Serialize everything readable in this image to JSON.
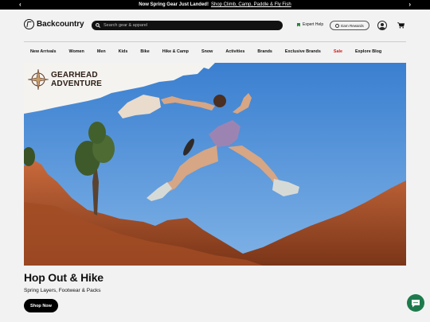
{
  "promo": {
    "text": "Now Spring Gear Just Landed!",
    "link": "Shop Climb, Camp, Paddle & Fly Fish",
    "prev_icon": "chevron-left-icon",
    "next_icon": "chevron-right-icon"
  },
  "header": {
    "logo": "Backcountry",
    "search_placeholder": "Search gear & apparel",
    "expert_help": "Expert Help",
    "rewards": "Earn Rewards"
  },
  "nav": {
    "items": [
      "New Arrivals",
      "Women",
      "Men",
      "Kids",
      "Bike",
      "Hike & Camp",
      "Snow",
      "Activities",
      "Brands",
      "Exclusive Brands",
      "Sale",
      "Explore Blog"
    ]
  },
  "hero": {
    "badge_line1": "GEARHEAD",
    "badge_line2": "ADVENTURE",
    "title": "Hop Out & Hike",
    "subtitle": "Spring Layers, Footwear & Packs",
    "cta": "Shop Now"
  },
  "colors": {
    "sale": "#d11a1a",
    "expert_flag": "#1f8a3b",
    "chat": "#1e7a4c"
  }
}
